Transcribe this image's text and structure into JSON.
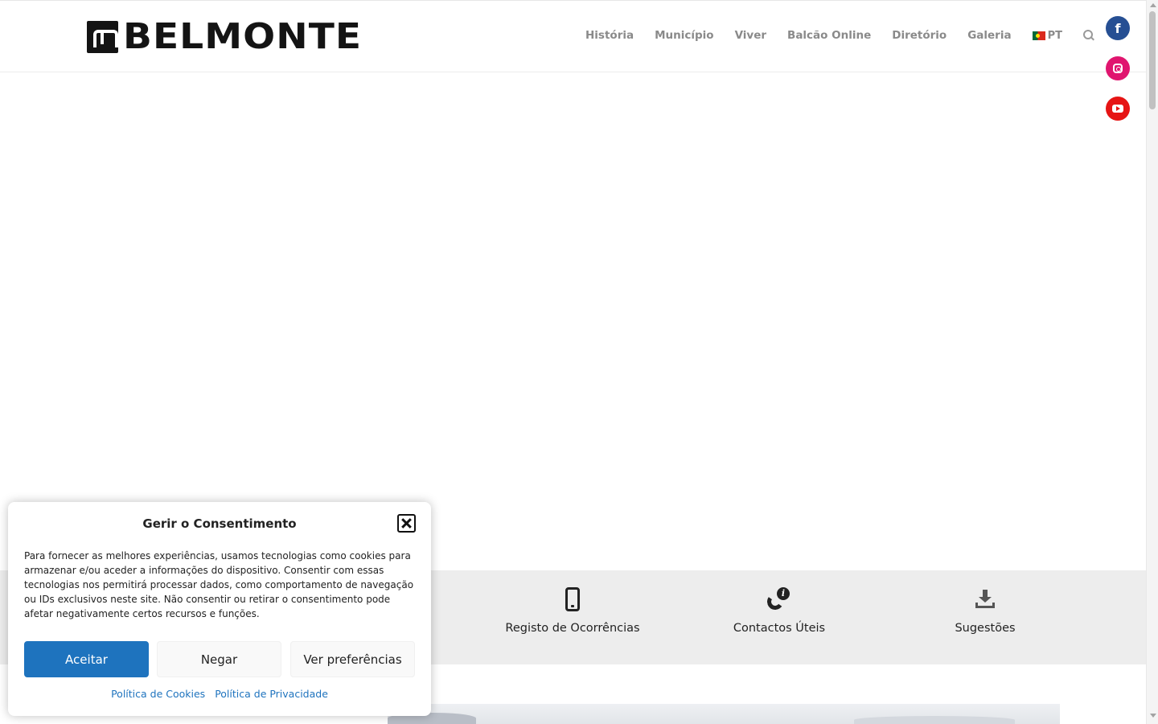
{
  "header": {
    "logo_text": "BELMONTE",
    "nav": [
      "História",
      "Município",
      "Viver",
      "Balcão Online",
      "Diretório",
      "Galeria"
    ],
    "lang_label": "PT"
  },
  "social": {
    "facebook_glyph": "f",
    "colors": {
      "facebook": "#264f93",
      "instagram": "#e0156f",
      "youtube": "#e61414"
    }
  },
  "services": [
    {
      "label": "Registo de Ocorrências",
      "icon": "mobile-phone-icon"
    },
    {
      "label": "Contactos Úteis",
      "icon": "phone-info-icon"
    },
    {
      "label": "Sugestões",
      "icon": "download-icon"
    }
  ],
  "consent": {
    "title": "Gerir o Consentimento",
    "body": "Para fornecer as melhores experiências, usamos tecnologias como cookies para armazenar e/ou aceder a informações do dispositivo. Consentir com essas tecnologias nos permitirá processar dados, como comportamento de navegação ou IDs exclusivos neste site. Não consentir ou retirar o consentimento pode afetar negativamente certos recursos e funções.",
    "accept_label": "Aceitar",
    "deny_label": "Negar",
    "prefs_label": "Ver preferências",
    "cookie_policy_label": "Política de Cookies",
    "privacy_policy_label": "Política de Privacidade",
    "accent_color": "#1e73be"
  },
  "service_info_glyph": "i"
}
